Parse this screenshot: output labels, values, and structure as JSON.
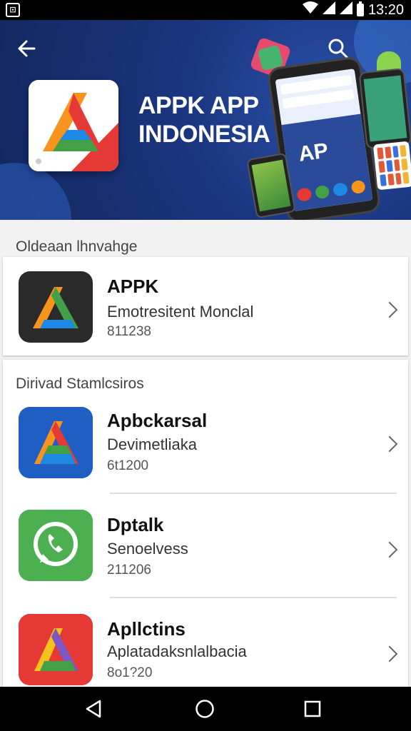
{
  "status_bar": {
    "time": "13:20",
    "icons": [
      "notification-icon",
      "wifi-icon",
      "signal-icon",
      "signal-icon",
      "battery-icon"
    ]
  },
  "hero": {
    "title_line1": "APPK APP",
    "title_line2": "INDONESIA",
    "phone_screen_text": "AP"
  },
  "section1": {
    "title": "Oldeaan lhnvahge",
    "items": [
      {
        "name": "APPK",
        "subtitle": "Emotresitent Monclal",
        "count": "811238"
      }
    ]
  },
  "section2": {
    "title": "Dirivad Stamlcsiros",
    "items": [
      {
        "name": "Apbckarsal",
        "subtitle": "Devimetliaka",
        "count": "6t1200"
      },
      {
        "name": "Dptalk",
        "subtitle": "Senoelvess",
        "count": "211206"
      },
      {
        "name": "Apllctins",
        "subtitle": "Aplatadaksnlalbacia",
        "count": "8o1?20"
      }
    ]
  },
  "colors": {
    "hero_bg": "#1a3680",
    "status_bar": "#000000",
    "nav_bar": "#000000",
    "accent_orange": "#f7941d",
    "accent_red": "#e53935",
    "accent_green": "#43a047"
  }
}
